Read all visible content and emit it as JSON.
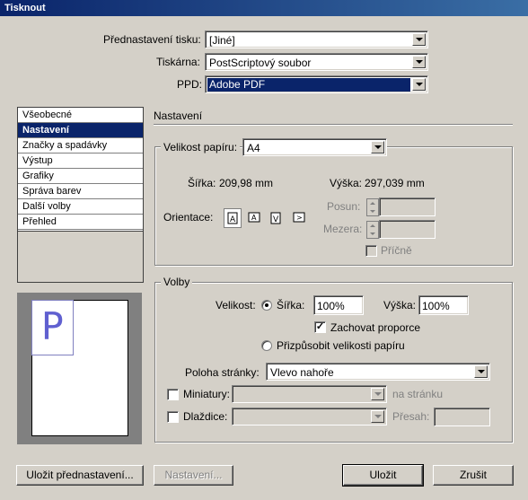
{
  "window": {
    "title": "Tisknout"
  },
  "top": {
    "preset_label": "Přednastavení tisku:",
    "preset_value": "[Jiné]",
    "printer_label": "Tiskárna:",
    "printer_value": "PostScriptový soubor",
    "ppd_label": "PPD:",
    "ppd_value": "Adobe PDF"
  },
  "sidebar": {
    "items": [
      {
        "label": "Všeobecné"
      },
      {
        "label": "Nastavení"
      },
      {
        "label": "Značky a spadávky"
      },
      {
        "label": "Výstup"
      },
      {
        "label": "Grafiky"
      },
      {
        "label": "Správa barev"
      },
      {
        "label": "Další volby"
      },
      {
        "label": "Přehled"
      }
    ],
    "selected_index": 1
  },
  "preview": {
    "glyph": "P"
  },
  "panel": {
    "title": "Nastavení"
  },
  "paper": {
    "size_label": "Velikost papíru:",
    "size_value": "A4",
    "width_label": "Šířka:",
    "width_value": "209,98 mm",
    "height_label": "Výška:",
    "height_value": "297,039 mm",
    "orientation_label": "Orientace:",
    "offset_label": "Posun:",
    "gap_label": "Mezera:",
    "transverse_label": "Příčně"
  },
  "options": {
    "group_title": "Volby",
    "scale_label": "Velikost:",
    "width_label": "Šířka:",
    "width_value": "100%",
    "height_label": "Výška:",
    "height_value": "100%",
    "keep_proportions_label": "Zachovat proporce",
    "keep_proportions_checked": true,
    "fit_label": "Přizpůsobit velikosti papíru",
    "page_position_label": "Poloha stránky:",
    "page_position_value": "Vlevo nahoře",
    "thumbnails_label": "Miniatury:",
    "per_page_label": "na stránku",
    "tiles_label": "Dlaždice:",
    "overlap_label": "Přesah:"
  },
  "buttons": {
    "save_preset": "Uložit přednastavení...",
    "setup": "Nastavení...",
    "save": "Uložit",
    "cancel": "Zrušit"
  },
  "colors": {
    "selection": "#0a246a",
    "dialog_bg": "#d4d0c8",
    "preview_glyph": "#6060d0"
  }
}
